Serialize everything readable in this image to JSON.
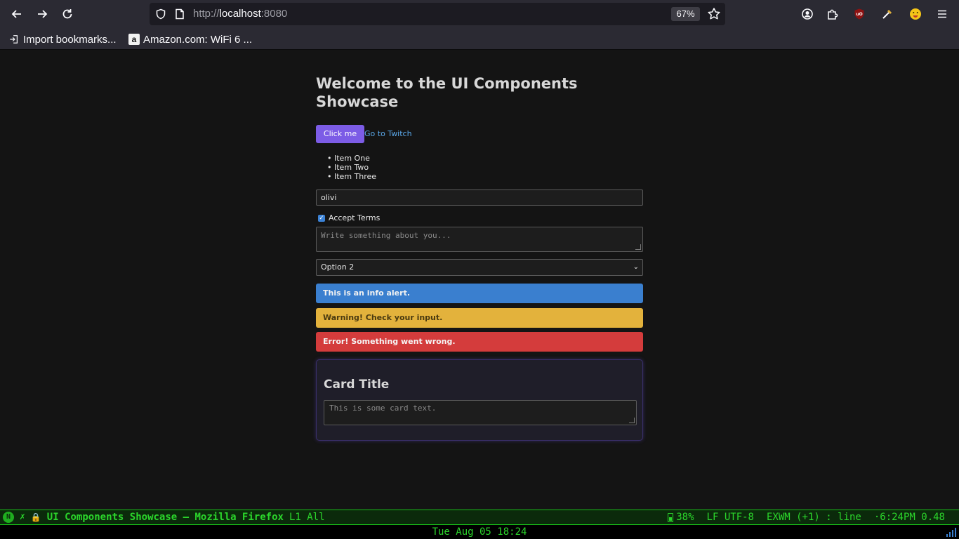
{
  "browser": {
    "url_scheme": "http://",
    "url_host": "localhost",
    "url_port": ":8080",
    "zoom": "67%",
    "bookmarks": [
      {
        "label": "Import bookmarks..."
      },
      {
        "label": "Amazon.com: WiFi 6 ..."
      }
    ],
    "amazon_icon_letter": "a"
  },
  "page": {
    "title": "Welcome to the UI Components Showcase",
    "button_label": "Click me",
    "link_label": "Go to Twitch",
    "list_items": [
      "Item One",
      "Item Two",
      "Item Three"
    ],
    "text_input_value": "olivi",
    "checkbox_label": "Accept Terms",
    "checkbox_checked": true,
    "textarea_placeholder": "Write something about you...",
    "select_value": "Option 2",
    "alerts": {
      "info": "This is an info alert.",
      "warning": "Warning! Check your input.",
      "error": "Error! Something went wrong."
    },
    "card": {
      "title": "Card Title",
      "textarea_placeholder": "This is some card text."
    }
  },
  "modeline": {
    "badge": "N",
    "title": "UI Components Showcase — Mozilla Firefox",
    "position": "L1 All",
    "battery": "38%",
    "encoding": "LF UTF-8",
    "mode": "EXWM (+1) : line",
    "time_load": "·6:24PM 0.48"
  },
  "minibuffer": {
    "datetime": "Tue Aug 05 18:24"
  },
  "colors": {
    "accent_button": "#7c5ce6",
    "link": "#5aa7e8",
    "alert_info": "#3a7fcf",
    "alert_warning": "#e3b23c",
    "alert_error": "#d43c3c",
    "modeline_text": "#2bd62b"
  }
}
